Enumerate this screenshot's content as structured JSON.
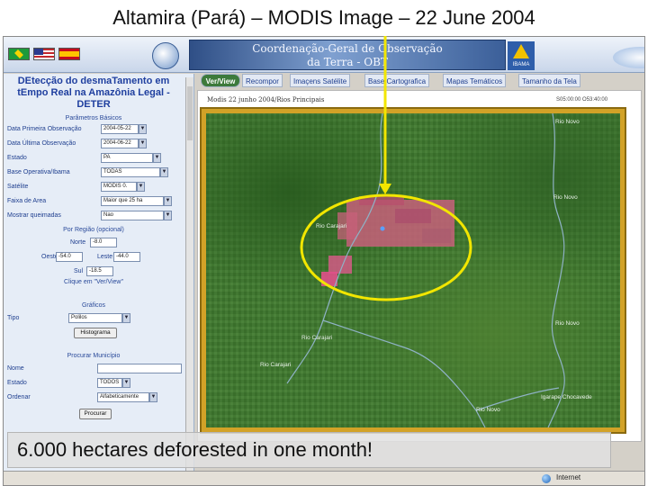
{
  "slide": {
    "title": "Altamira (Pará) – MODIS Image – 22 June 2004",
    "caption": "6.000 hectares deforested in one month!"
  },
  "banner": {
    "line1": "Coordenação-Geral de Observação",
    "line2": "da Terra - OBT",
    "ibama_label": "IBAMA"
  },
  "panel": {
    "heading": "DEtecção do desmaTamento em tEmpo Real na Amazônia Legal - DETER",
    "params_title": "Parâmetros Básicos",
    "fields": {
      "data_primeira": {
        "label": "Data Primeira Observação",
        "value": "2004-05-22"
      },
      "data_ultima": {
        "label": "Data Última Observação",
        "value": "2004-06-22"
      },
      "estado": {
        "label": "Estado",
        "value": "PA"
      },
      "base_operativa": {
        "label": "Base Operativa/Ibama",
        "value": "TODAS"
      },
      "satelite": {
        "label": "Satélite",
        "value": "MODIS 0."
      },
      "faixa_area": {
        "label": "Faixa de Area",
        "value": "Maior que 25 ha"
      },
      "mostrar_queimadas": {
        "label": "Mostrar queimadas",
        "value": "Nao"
      }
    },
    "region": {
      "title": "Por Região (opcional)",
      "norte_label": "Norte",
      "norte_value": "-8.0",
      "oeste_label": "Oeste",
      "oeste_value": "-54.0",
      "leste_label": "Leste",
      "leste_value": "-44.0",
      "sul_label": "Sul",
      "sul_value": "-18.5",
      "hint": "Clique em \"Ver/View\""
    },
    "graficos": {
      "title": "Gráficos",
      "tipo_label": "Tipo",
      "tipo_value": "Polilos",
      "button": "Histograma"
    },
    "municipio": {
      "title": "Procurar Município",
      "nome_label": "Nome",
      "estado_label": "Estado",
      "estado_value": "TODOS",
      "ordenar_label": "Ordenar",
      "ordenar_value": "Alfabeticamente",
      "button": "Procurar"
    }
  },
  "tabs": [
    {
      "label": "Ver/View"
    },
    {
      "label": "Recompor"
    },
    {
      "label": "Imaçens Satélite"
    },
    {
      "label": "Base Cartografica"
    },
    {
      "label": "Mapas Temáticos"
    },
    {
      "label": "Tamanho da Tela"
    }
  ],
  "map": {
    "caption": "Modis 22 junho 2004/Rios Principais",
    "coords": "S05:00:00 O53:40:00",
    "rivers": [
      {
        "name": "Rio Novo"
      },
      {
        "name": "Rio Novo"
      },
      {
        "name": "Rio Carajari"
      },
      {
        "name": "Rio Novo"
      },
      {
        "name": "Rio Carajari"
      },
      {
        "name": "Rio Carajari"
      },
      {
        "name": "Rio Novo"
      },
      {
        "name": "Igarape Chocavede"
      }
    ]
  },
  "status": {
    "zone": "Internet"
  },
  "colors": {
    "annotation": "#f2e600",
    "deforestation": "#c7607a",
    "map_border": "#d2a227",
    "forest": "#3f7a2e"
  }
}
